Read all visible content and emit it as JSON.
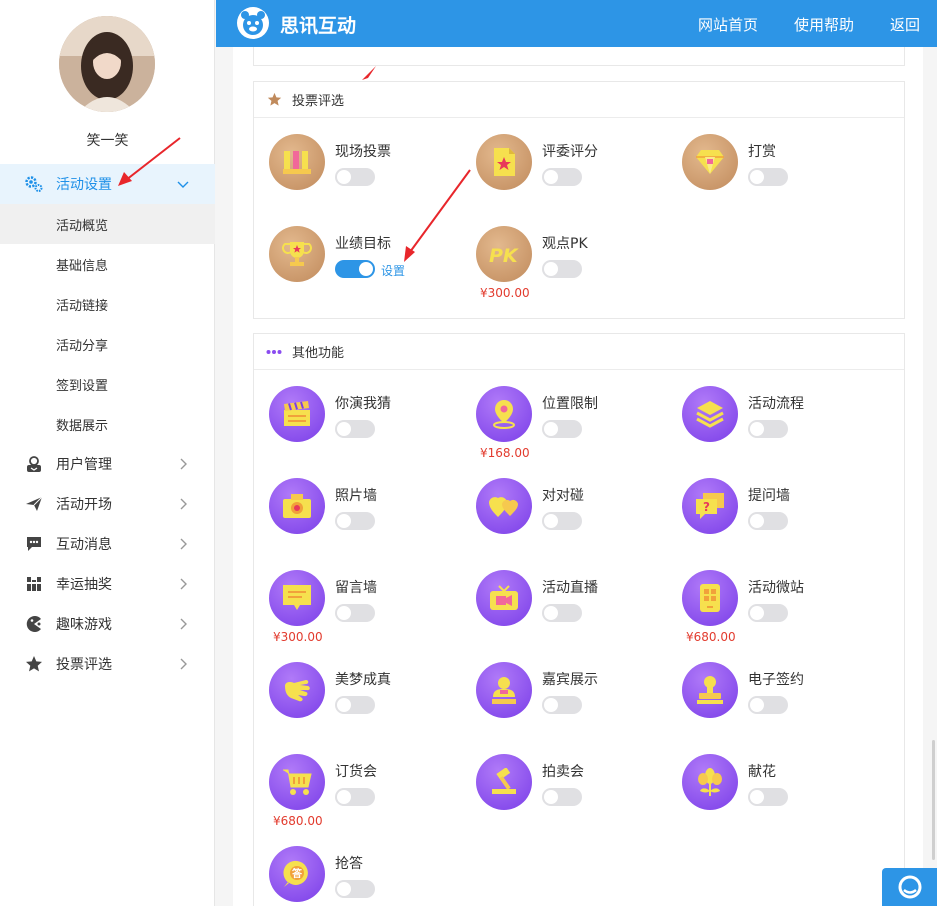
{
  "header": {
    "brand": "思讯互动",
    "nav": [
      "网站首页",
      "使用帮助",
      "返回"
    ]
  },
  "user": {
    "name": "笑一笑"
  },
  "sidebar": {
    "active": {
      "label": "活动设置",
      "icon": "gear-icon"
    },
    "submenu": [
      "活动概览",
      "基础信息",
      "活动链接",
      "活动分享",
      "签到设置",
      "数据展示"
    ],
    "items": [
      {
        "label": "用户管理",
        "icon": "user-icon"
      },
      {
        "label": "活动开场",
        "icon": "paper-plane-icon"
      },
      {
        "label": "互动消息",
        "icon": "chat-icon"
      },
      {
        "label": "幸运抽奖",
        "icon": "lottery-icon"
      },
      {
        "label": "趣味游戏",
        "icon": "game-icon"
      },
      {
        "label": "投票评选",
        "icon": "star-icon"
      }
    ]
  },
  "vote_panel": {
    "title": "投票评选",
    "features": [
      {
        "name": "现场投票",
        "on": false,
        "price": "",
        "icon": "bar-chart-icon"
      },
      {
        "name": "评委评分",
        "on": false,
        "price": "",
        "icon": "score-card-icon"
      },
      {
        "name": "打赏",
        "on": false,
        "price": "",
        "icon": "diamond-icon"
      },
      {
        "name": "业绩目标",
        "on": true,
        "price": "",
        "setting": "设置",
        "icon": "trophy-icon"
      },
      {
        "name": "观点PK",
        "on": false,
        "price": "¥300.00",
        "icon": "pk-icon"
      }
    ]
  },
  "other_panel": {
    "title": "其他功能",
    "features": [
      {
        "name": "你演我猜",
        "on": false,
        "price": "",
        "icon": "clapperboard-icon"
      },
      {
        "name": "位置限制",
        "on": false,
        "price": "¥168.00",
        "icon": "location-pin-icon"
      },
      {
        "name": "活动流程",
        "on": false,
        "price": "",
        "icon": "layers-icon"
      },
      {
        "name": "照片墙",
        "on": false,
        "price": "",
        "icon": "camera-icon"
      },
      {
        "name": "对对碰",
        "on": false,
        "price": "",
        "icon": "hearts-icon"
      },
      {
        "name": "提问墙",
        "on": false,
        "price": "",
        "icon": "question-bubble-icon"
      },
      {
        "name": "留言墙",
        "on": false,
        "price": "¥300.00",
        "icon": "message-board-icon"
      },
      {
        "name": "活动直播",
        "on": false,
        "price": "",
        "icon": "tv-icon"
      },
      {
        "name": "活动微站",
        "on": false,
        "price": "¥680.00",
        "icon": "phone-icon"
      },
      {
        "name": "美梦成真",
        "on": false,
        "price": "",
        "icon": "hand-icon"
      },
      {
        "name": "嘉宾展示",
        "on": false,
        "price": "",
        "icon": "guest-icon"
      },
      {
        "name": "电子签约",
        "on": false,
        "price": "",
        "icon": "stamp-icon"
      },
      {
        "name": "订货会",
        "on": false,
        "price": "¥680.00",
        "icon": "cart-icon"
      },
      {
        "name": "拍卖会",
        "on": false,
        "price": "",
        "icon": "gavel-icon"
      },
      {
        "name": "献花",
        "on": false,
        "price": "",
        "icon": "flower-icon"
      },
      {
        "name": "抢答",
        "on": false,
        "price": "",
        "icon": "quiz-icon"
      }
    ]
  },
  "colors": {
    "accent": "#2d95e6",
    "price": "#e23b2e",
    "brown_icon": "#c08a5c",
    "purple_icon": "#7a3ee8"
  }
}
